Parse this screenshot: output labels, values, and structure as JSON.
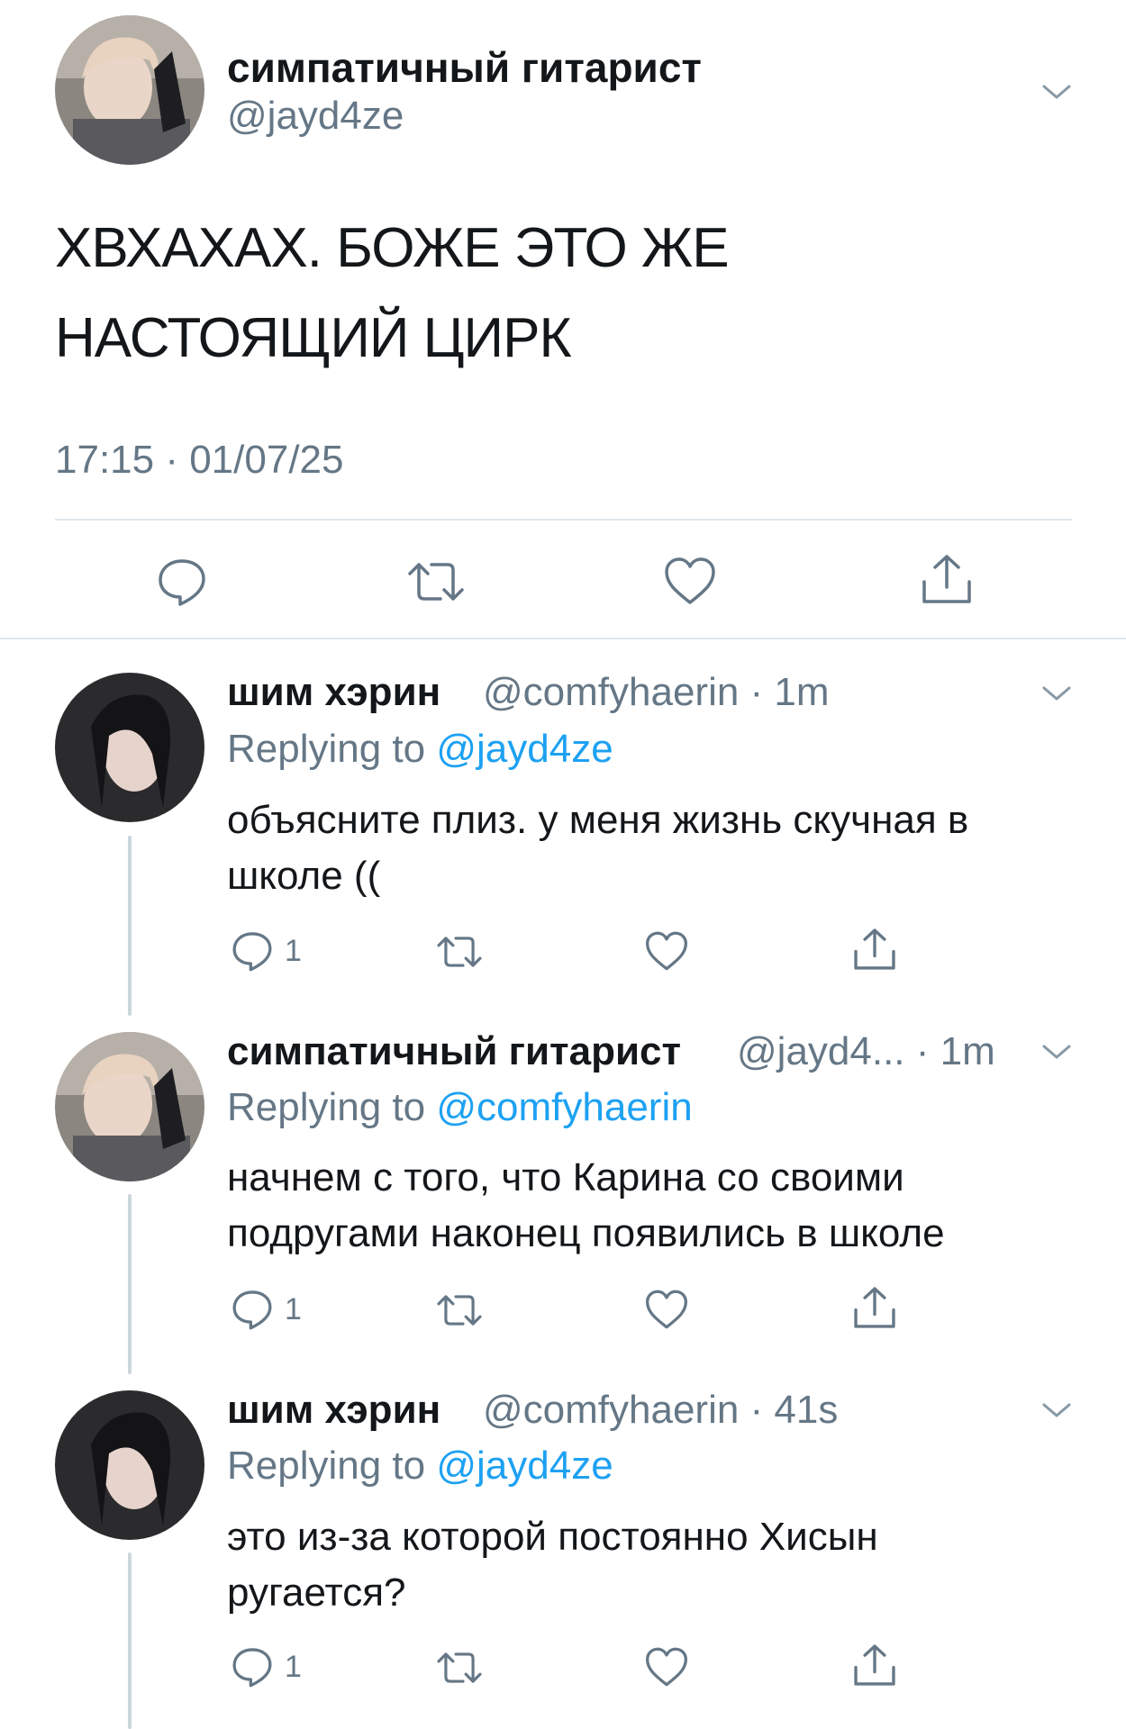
{
  "main_tweet": {
    "display_name": "симпатичный гитарист",
    "handle": "@jayd4ze",
    "text_line1": "ХВХАХАХ. БОЖЕ ЭТО ЖЕ",
    "text_line2": "НАСТОЯЩИЙ ЦИРК",
    "timestamp": "17:15 · 01/07/25"
  },
  "replies": [
    {
      "display_name": "шим хэрин",
      "handle_time": "@comfyhaerin · 1m",
      "replying_prefix": "Replying to ",
      "replying_handle": "@jayd4ze",
      "text_line1": "объясните плиз. у меня жизнь скучная в",
      "text_line2": "школе ((",
      "reply_count": "1"
    },
    {
      "display_name": "симпатичный гитарист",
      "handle_time": "@jayd4... · 1m",
      "replying_prefix": "Replying to ",
      "replying_handle": "@comfyhaerin",
      "text_line1": "начнем с того, что Карина со своими",
      "text_line2": "подругами наконец появились в школе",
      "reply_count": "1"
    },
    {
      "display_name": "шим хэрин",
      "handle_time": "@comfyhaerin · 41s",
      "replying_prefix": "Replying to ",
      "replying_handle": "@jayd4ze",
      "text_line1": "это из-за которой постоянно Хисын",
      "text_line2": "ругается?",
      "reply_count": "1"
    }
  ],
  "colors": {
    "text": "#14171a",
    "secondary": "#657786",
    "link": "#1da1f2",
    "divider": "#e1e8ed"
  },
  "icons": [
    "chevron-down-icon",
    "reply-icon",
    "retweet-icon",
    "like-icon",
    "share-icon"
  ]
}
